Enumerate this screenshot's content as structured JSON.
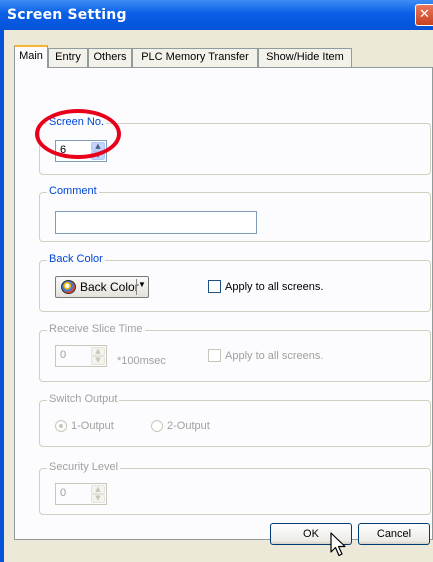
{
  "window": {
    "title": "Screen Setting"
  },
  "tabs": [
    {
      "label": "Main"
    },
    {
      "label": "Entry"
    },
    {
      "label": "Others"
    },
    {
      "label": "PLC Memory Transfer"
    },
    {
      "label": "Show/Hide Item"
    }
  ],
  "screen_no": {
    "label": "Screen No.",
    "value": "6"
  },
  "comment": {
    "label": "Comment",
    "value": ""
  },
  "back_color": {
    "label": "Back Color",
    "button_label": "Back Color",
    "apply_all": "Apply to all screens."
  },
  "receive_slice": {
    "label": "Receive Slice Time",
    "value": "0",
    "unit": "*100msec",
    "apply_all": "Apply to all screens."
  },
  "switch_output": {
    "label": "Switch Output",
    "option1": "1-Output",
    "option2": "2-Output"
  },
  "security_level": {
    "label": "Security Level",
    "value": "0"
  },
  "footer": {
    "ok": "OK",
    "cancel": "Cancel"
  },
  "colors": {
    "title_bar": "#0553d8",
    "highlight_circle": "#e8001a",
    "group_label": "#0046d5"
  }
}
